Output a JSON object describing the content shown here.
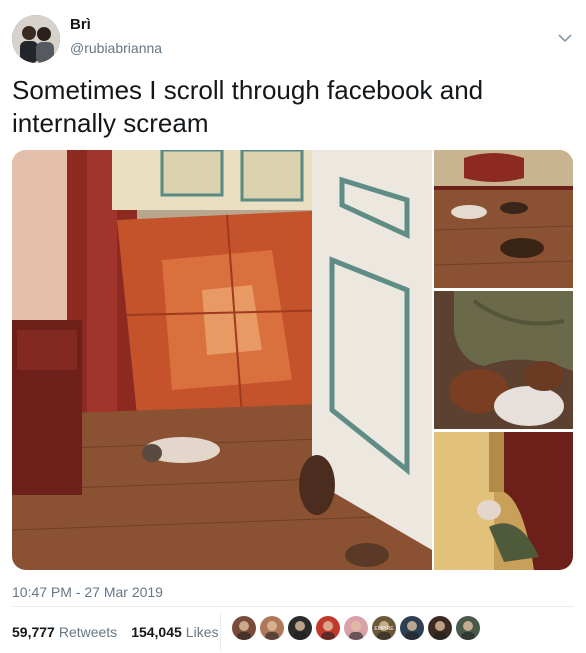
{
  "author": {
    "display_name": "Brì",
    "handle": "@rubiabrianna",
    "avatar_icon": "profile-photo-avatar"
  },
  "tweet": {
    "text": "Sometimes I scroll through facebook and internally scream",
    "timestamp": "10:47 PM - 27 Mar 2019"
  },
  "stats": {
    "retweets_count": "59,777",
    "retweets_label": "Retweets",
    "likes_count": "154,045",
    "likes_label": "Likes"
  },
  "likers": [
    {
      "name": "liker-avatar-1",
      "color": "#7a4b3a"
    },
    {
      "name": "liker-avatar-2",
      "color": "#b07a5a"
    },
    {
      "name": "liker-avatar-3",
      "color": "#2b2b2b"
    },
    {
      "name": "liker-avatar-4",
      "color": "#c0392b"
    },
    {
      "name": "liker-avatar-5",
      "color": "#d9a0a8"
    },
    {
      "name": "liker-avatar-6",
      "color": "#6b5a3a",
      "badge": "EMPIRE"
    },
    {
      "name": "liker-avatar-7",
      "color": "#2c3e50"
    },
    {
      "name": "liker-avatar-8",
      "color": "#3b2a22"
    },
    {
      "name": "liker-avatar-9",
      "color": "#4a5a4a"
    }
  ],
  "colors": {
    "text_primary": "#14171a",
    "text_secondary": "#657786",
    "divider": "#e6ecf0"
  }
}
